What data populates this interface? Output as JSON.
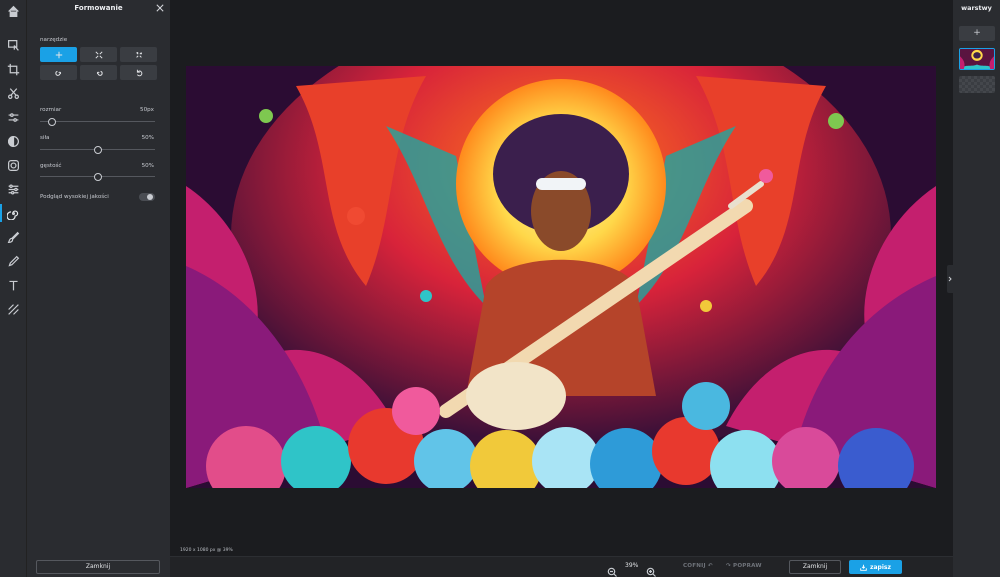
{
  "panel": {
    "title": "Formowanie",
    "tool_label": "narzędzie",
    "tools": [
      {
        "icon": "move-arrows-icon",
        "active": true
      },
      {
        "icon": "grow-icon",
        "active": false
      },
      {
        "icon": "shrink-icon",
        "active": false
      },
      {
        "icon": "swirl-left-icon",
        "active": false
      },
      {
        "icon": "swirl-right-icon",
        "active": false
      },
      {
        "icon": "restore-icon",
        "active": false
      }
    ],
    "size_label": "rozmiar",
    "size_value": "50px",
    "size_level": 0.1,
    "strength_label": "siła",
    "strength_value": "50%",
    "strength_level": 0.5,
    "density_label": "gęstość",
    "density_value": "50%",
    "density_level": 0.5,
    "hq_preview_label": "Podgląd wysokiej jakości",
    "hq_preview_on": false,
    "close_label": "Zamknij"
  },
  "toolbar": {
    "items": [
      "home-icon",
      "select-icon",
      "crop-icon",
      "cut-icon",
      "adjust-icon",
      "filter-icon",
      "sliders-icon",
      "liquify-icon",
      "brush-icon",
      "pen-icon",
      "text-icon",
      "texture-icon"
    ],
    "active": "liquify-icon"
  },
  "workspace": {
    "image_info": "1920 x 1080 px @ 39%"
  },
  "bottom": {
    "zoom": "39%",
    "undo_label": "COFNIJ",
    "redo_label": "POPRAW",
    "close_label": "Zamknij",
    "save_label": "zapisz"
  },
  "layers": {
    "title": "warstwy",
    "add_label": "+"
  },
  "colors": {
    "accent": "#1aa1e6",
    "panel": "#2a2c30",
    "workspace": "#1b1c1f"
  }
}
